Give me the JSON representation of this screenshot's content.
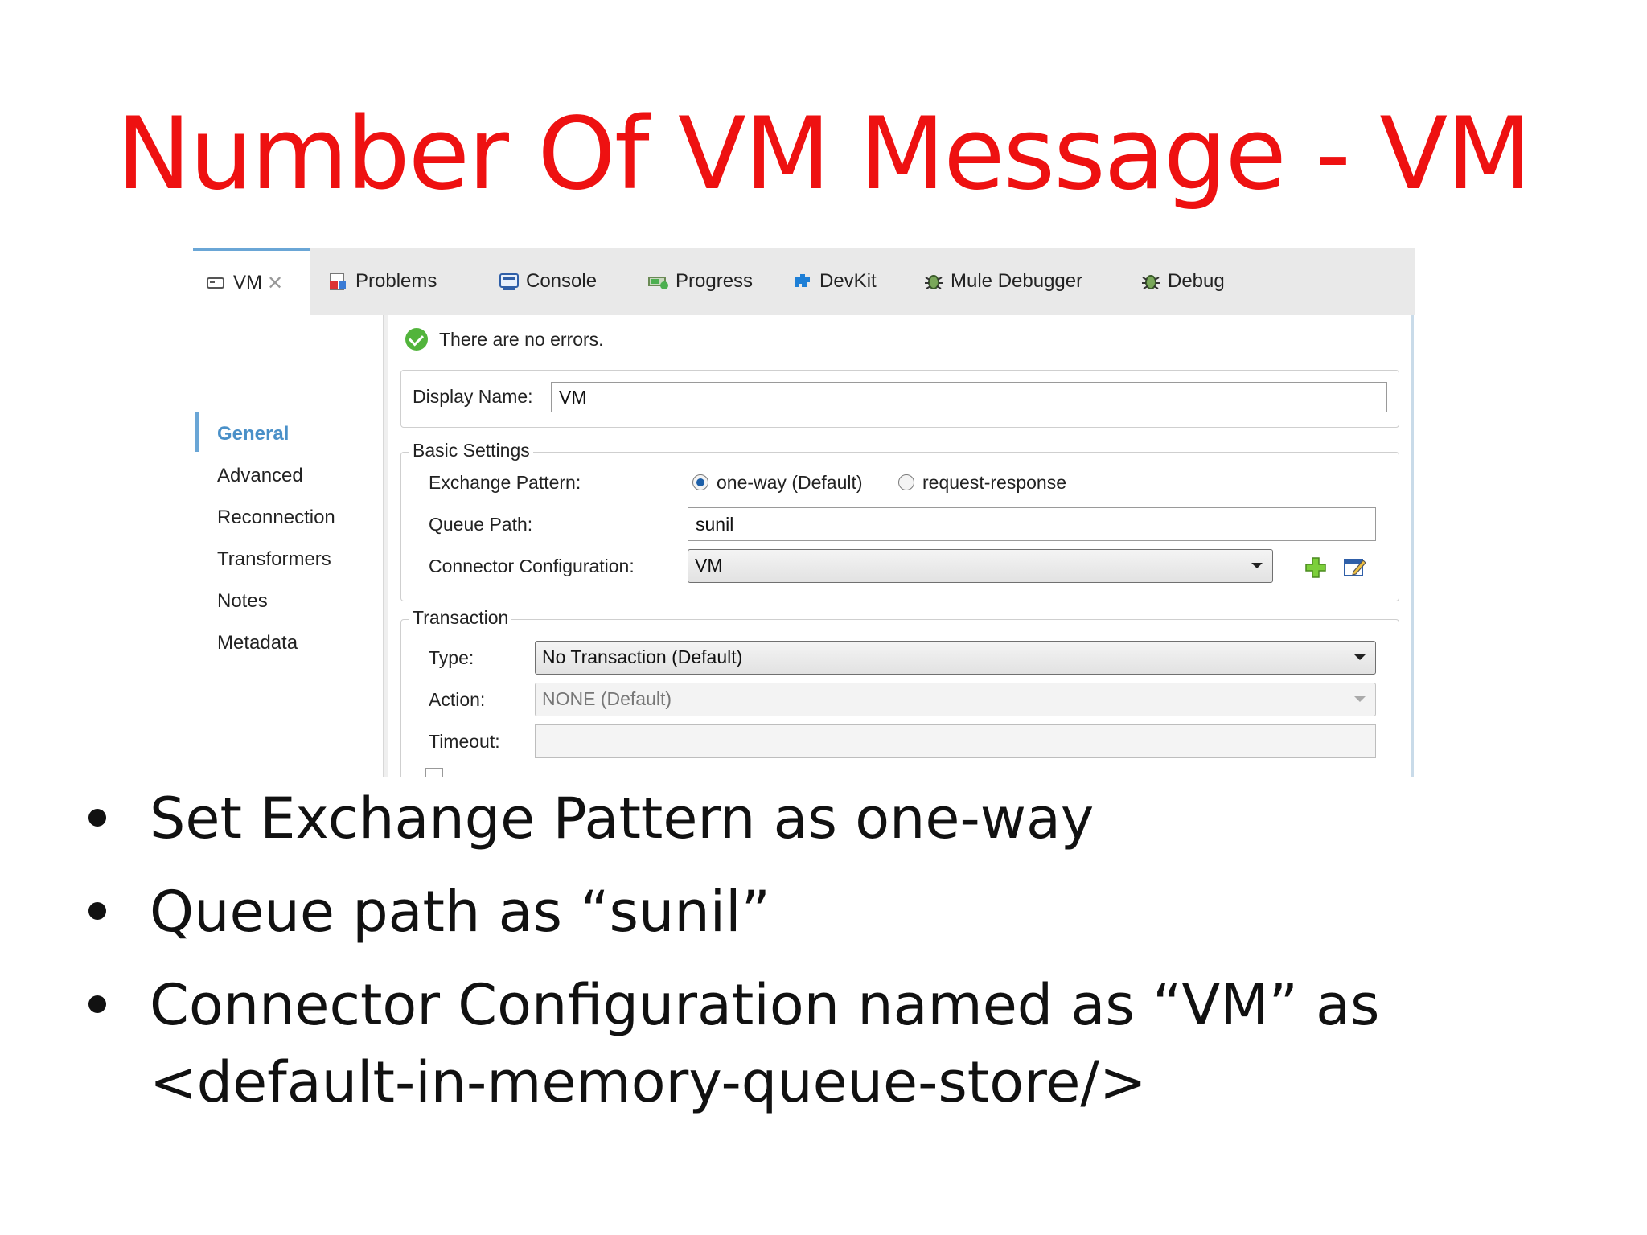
{
  "slide": {
    "title": "Number Of VM Message - VM",
    "bullets": [
      "Set Exchange Pattern as one-way",
      "Queue path as “sunil”",
      "Connector Configuration named as “VM” as",
      "<default-in-memory-queue-store/>"
    ]
  },
  "tabs": [
    {
      "label": "VM",
      "icon": "vm-icon"
    },
    {
      "label": "Problems",
      "icon": "problems-icon"
    },
    {
      "label": "Console",
      "icon": "console-icon"
    },
    {
      "label": "Progress",
      "icon": "progress-icon"
    },
    {
      "label": "DevKit",
      "icon": "devkit-icon"
    },
    {
      "label": "Mule Debugger",
      "icon": "bug-icon"
    },
    {
      "label": "Debug",
      "icon": "bug-icon"
    }
  ],
  "sidebar": {
    "items": [
      "General",
      "Advanced",
      "Reconnection",
      "Transformers",
      "Notes",
      "Metadata"
    ],
    "active": "General"
  },
  "status": {
    "message": "There are no errors."
  },
  "form": {
    "display_name_label": "Display Name:",
    "display_name_value": "VM",
    "basic_settings": {
      "legend": "Basic Settings",
      "exchange_label": "Exchange Pattern:",
      "option_one_way": "one-way (Default)",
      "option_request_response": "request-response",
      "selected": "one-way",
      "queue_label": "Queue Path:",
      "queue_value": "sunil",
      "connector_label": "Connector Configuration:",
      "connector_value": "VM"
    },
    "transaction": {
      "legend": "Transaction",
      "type_label": "Type:",
      "type_value": "No Transaction (Default)",
      "action_label": "Action:",
      "action_value": "NONE (Default)",
      "timeout_label": "Timeout:",
      "timeout_value": ""
    }
  },
  "colors": {
    "title": "#ee1111",
    "accent": "#6aa6d6",
    "ok": "#52b43c"
  }
}
